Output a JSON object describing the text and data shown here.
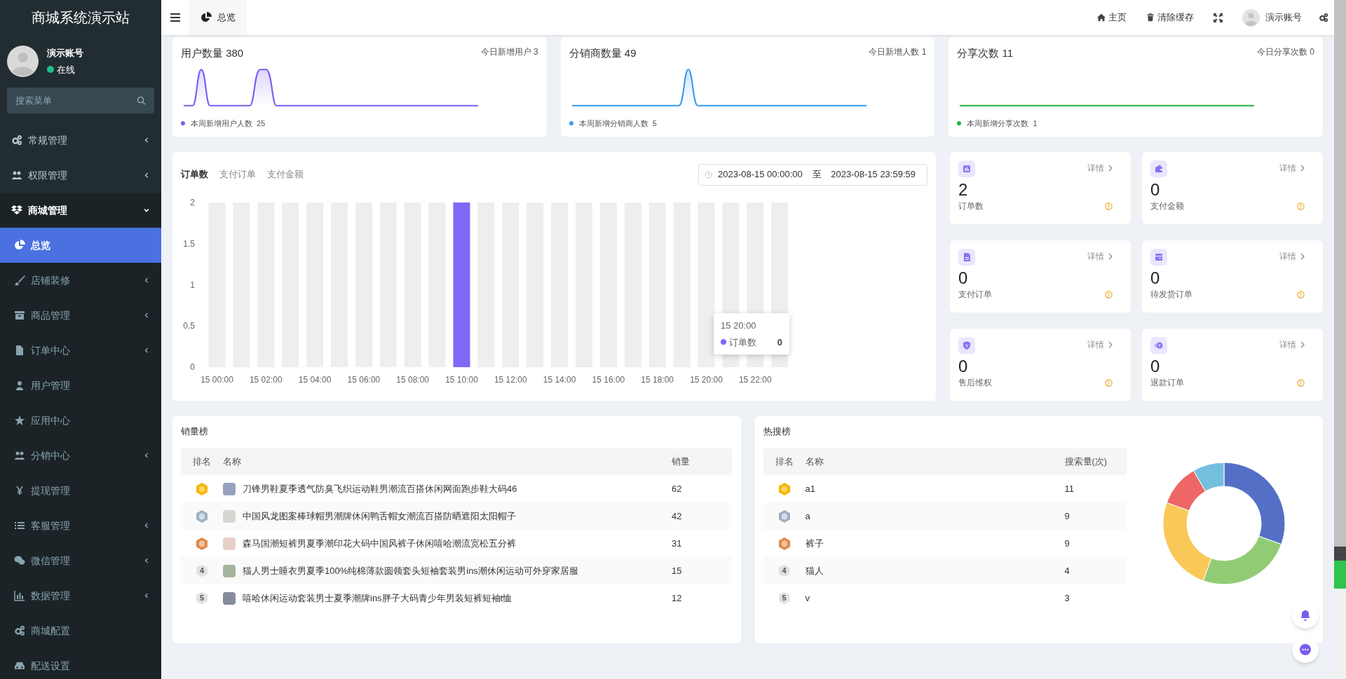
{
  "sidebar": {
    "title": "商城系统演示站",
    "user": {
      "name": "演示账号",
      "status": "在线"
    },
    "search": {
      "placeholder": "搜索菜单"
    },
    "items": [
      {
        "label": "常规管理",
        "selected": false,
        "expanded": false
      },
      {
        "label": "权限管理",
        "selected": false,
        "expanded": false
      },
      {
        "label": "商城管理",
        "selected": false,
        "expanded": true,
        "children": [
          {
            "label": "总览",
            "selected": true
          },
          {
            "label": "店铺装修",
            "selected": false,
            "expanded": false
          },
          {
            "label": "商品管理",
            "selected": false,
            "expanded": false
          },
          {
            "label": "订单中心",
            "selected": false,
            "expanded": false
          },
          {
            "label": "用户管理",
            "selected": false
          },
          {
            "label": "应用中心",
            "selected": false
          },
          {
            "label": "分销中心",
            "selected": false,
            "expanded": false
          },
          {
            "label": "提现管理",
            "selected": false
          },
          {
            "label": "客服管理",
            "selected": false,
            "expanded": false
          },
          {
            "label": "微信管理",
            "selected": false,
            "expanded": false
          },
          {
            "label": "数据管理",
            "selected": false,
            "expanded": false
          },
          {
            "label": "商城配置",
            "selected": false
          },
          {
            "label": "配送设置",
            "selected": false
          }
        ]
      }
    ]
  },
  "header": {
    "tabs": [
      {
        "label": "总览",
        "selected": true
      }
    ],
    "links": [
      {
        "label": "主页"
      },
      {
        "label": "清除缓存"
      }
    ],
    "user": "演示账号"
  },
  "stat_cards": [
    {
      "title": "用户数量",
      "value": "380",
      "today_label": "今日新增用户",
      "today_value": "3",
      "legend": "本周新增用户人数",
      "legend_value": "25",
      "color": "#7b5cf0"
    },
    {
      "title": "分销商数量",
      "value": "49",
      "today_label": "今日新增人数",
      "today_value": "1",
      "legend": "本周新增分销商人数",
      "legend_value": "5",
      "color": "#3a98f5"
    },
    {
      "title": "分享次数",
      "value": "11",
      "today_label": "今日分享次数",
      "today_value": "0",
      "legend": "本周新增分享次数",
      "legend_value": "1",
      "color": "#22b33a"
    }
  ],
  "order_chart": {
    "tabs": [
      {
        "label": "订单数",
        "selected": true
      },
      {
        "label": "支付订单",
        "selected": false
      },
      {
        "label": "支付金额",
        "selected": false
      }
    ],
    "date_start": "2023-08-15 00:00:00",
    "separator": "至",
    "date_end": "2023-08-15 23:59:59",
    "chart_data": {
      "type": "bar",
      "categories": [
        "15 00:00",
        null,
        "15 02:00",
        null,
        "15 04:00",
        null,
        "15 06:00",
        null,
        "15 08:00",
        null,
        "15 10:00",
        null,
        "15 12:00",
        null,
        "15 14:00",
        null,
        "15 16:00",
        null,
        "15 18:00",
        null,
        "15 20:00",
        null,
        "15 22:00",
        null
      ],
      "series": [
        {
          "name": "订单数",
          "color": "#8068f5",
          "values": [
            0,
            0,
            0,
            0,
            0,
            0,
            0,
            0,
            0,
            0,
            2,
            0,
            0,
            0,
            0,
            0,
            0,
            0,
            0,
            0,
            0,
            0,
            0,
            0
          ]
        }
      ],
      "ylim": [
        0,
        2
      ],
      "yticks": [
        0,
        0.5,
        1,
        1.5,
        2
      ]
    },
    "tooltip": {
      "title": "15 20:00",
      "value": "0"
    }
  },
  "metrics": [
    {
      "value": "2",
      "label": "订单数",
      "link": "详情"
    },
    {
      "value": "0",
      "label": "支付金额",
      "link": "详情"
    },
    {
      "value": "0",
      "label": "支付订单",
      "link": "详情"
    },
    {
      "value": "0",
      "label": "待发货订单",
      "link": "详情"
    },
    {
      "value": "0",
      "label": "售后维权",
      "link": "详情"
    },
    {
      "value": "0",
      "label": "退款订单",
      "link": "详情"
    }
  ],
  "sales_rank": {
    "title": "销量榜",
    "columns": [
      "排名",
      "名称",
      "销量"
    ],
    "rows": [
      {
        "kind": "gold",
        "color": "#96a1bf",
        "name": "刀锋男鞋夏季透气防臭飞织运动鞋男潮流百搭休闲网面跑步鞋大码46",
        "sales": "62"
      },
      {
        "kind": "silver",
        "color": "#d6d6d3",
        "name": "中国风龙图案棒球帽男潮牌休闲鸭舌帽女潮流百搭防晒遮阳太阳帽子",
        "sales": "42"
      },
      {
        "kind": "bronze",
        "color": "#e8d0c8",
        "name": "森马国潮短裤男夏季潮印花大码中国风裤子休闲嘻哈潮流宽松五分裤",
        "sales": "31"
      },
      {
        "kind": "plain",
        "rank": "4",
        "color": "#a3b59b",
        "name": "猫人男士睡衣男夏季100%纯棉薄款圆领套头短袖套装男ins潮休闲运动可外穿家居服",
        "sales": "15"
      },
      {
        "kind": "plain",
        "rank": "5",
        "color": "#878c9c",
        "name": "嘻哈休闲运动套装男士夏季潮牌ins胖子大码青少年男装短裤短袖t恤",
        "sales": "12"
      }
    ]
  },
  "hot_search": {
    "title": "热搜榜",
    "columns": [
      "排名",
      "名称",
      "搜索量(次)"
    ],
    "rows": [
      {
        "kind": "gold",
        "name": "a1",
        "count": "11"
      },
      {
        "kind": "silver",
        "name": "a",
        "count": "9"
      },
      {
        "kind": "bronze",
        "name": "裤子",
        "count": "9"
      },
      {
        "kind": "plain",
        "rank": "4",
        "name": "猫人",
        "count": "4"
      },
      {
        "kind": "plain",
        "rank": "5",
        "name": "v",
        "count": "3"
      }
    ]
  }
}
